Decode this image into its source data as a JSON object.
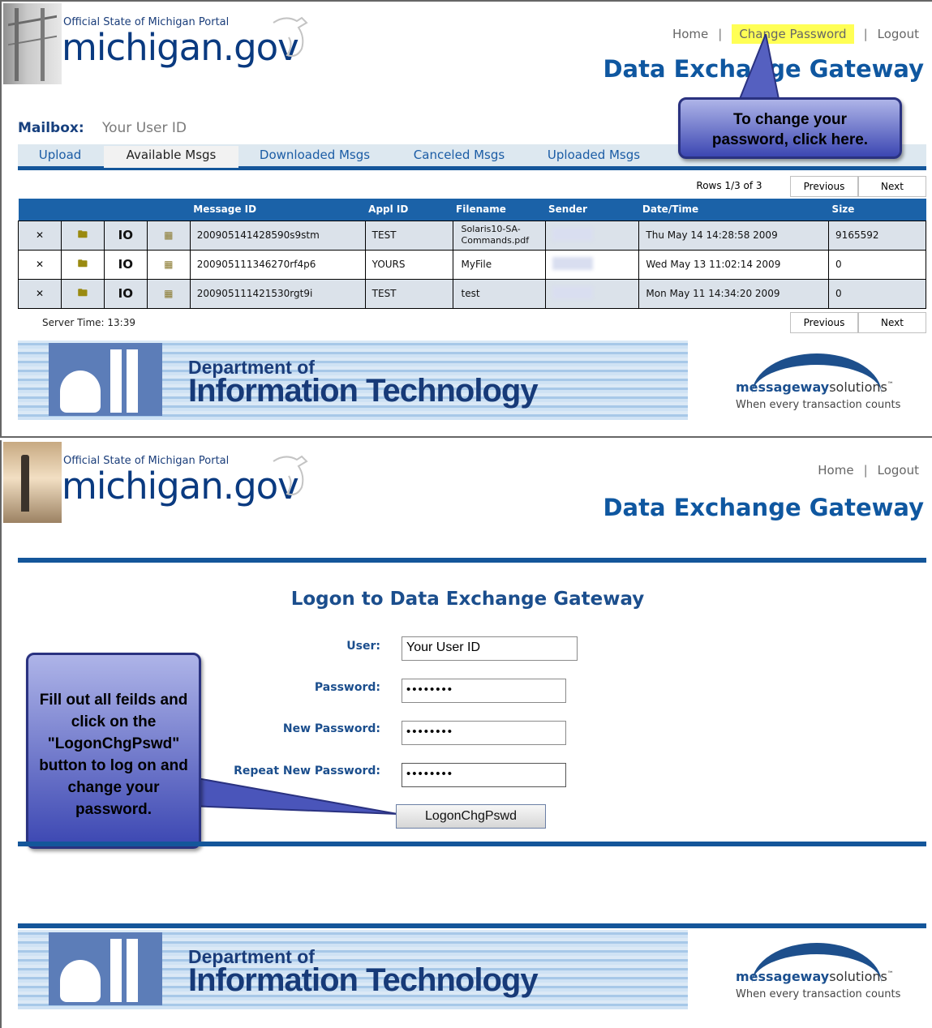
{
  "header": {
    "portal_subtitle": "Official State of Michigan Portal",
    "portal_name": "michigan.gov",
    "gateway_title": "Data Exchange Gateway"
  },
  "panel1": {
    "links": {
      "home": "Home",
      "change_password": "Change Password",
      "logout": "Logout"
    },
    "mailbox_label": "Mailbox:",
    "mailbox_value": "Your User ID",
    "tabs": [
      "Upload",
      "Available Msgs",
      "Downloaded Msgs",
      "Canceled Msgs",
      "Uploaded Msgs"
    ],
    "rows_info": "Rows 1/3 of 3",
    "previous": "Previous",
    "next": "Next",
    "columns": [
      "Message ID",
      "Appl ID",
      "Filename",
      "Sender",
      "Date/Time",
      "Size"
    ],
    "row_icons": {
      "delete": "✕",
      "download": "🖿",
      "io": "IO",
      "details": "▦"
    },
    "rows": [
      {
        "message_id": "200905141428590s9stm",
        "appl_id": "TEST",
        "filename": "Solaris10-SA-Commands.pdf",
        "date_time": "Thu May 14 14:28:58 2009",
        "size": "9165592"
      },
      {
        "message_id": "200905111346270rf4p6",
        "appl_id": "YOURS",
        "filename": "MyFile",
        "date_time": "Wed May 13 11:02:14 2009",
        "size": "0"
      },
      {
        "message_id": "200905111421530rgt9i",
        "appl_id": "TEST",
        "filename": "test",
        "date_time": "Mon May 11 14:34:20 2009",
        "size": "0"
      }
    ],
    "server_time": "Server Time: 13:39",
    "callout": "To change your password, click here."
  },
  "banner": {
    "dept_line1": "Department of",
    "dept_line2": "Information Technology",
    "mw_brand_bold": "messageway",
    "mw_brand_rest": "solutions",
    "mw_tm": "™",
    "mw_tagline": "When every transaction counts"
  },
  "panel2": {
    "links": {
      "home": "Home",
      "logout": "Logout"
    },
    "logon_title": "Logon to Data Exchange Gateway",
    "fields": {
      "user_label": "User:",
      "user_value": "Your User ID",
      "password_label": "Password:",
      "password_value": "••••••••",
      "new_password_label": "New Password:",
      "new_password_value": "••••••••",
      "repeat_label": "Repeat New Password:",
      "repeat_value": "••••••••"
    },
    "button": "LogonChgPswd",
    "callout": "Fill out all feilds and click on the \"LogonChgPswd\" button to log on and change your password."
  },
  "colors": {
    "brand_blue": "#14569a",
    "gateway_blue": "#0f57a0",
    "highlight": "#ffff55",
    "callout_blue": "#3c47b2"
  }
}
